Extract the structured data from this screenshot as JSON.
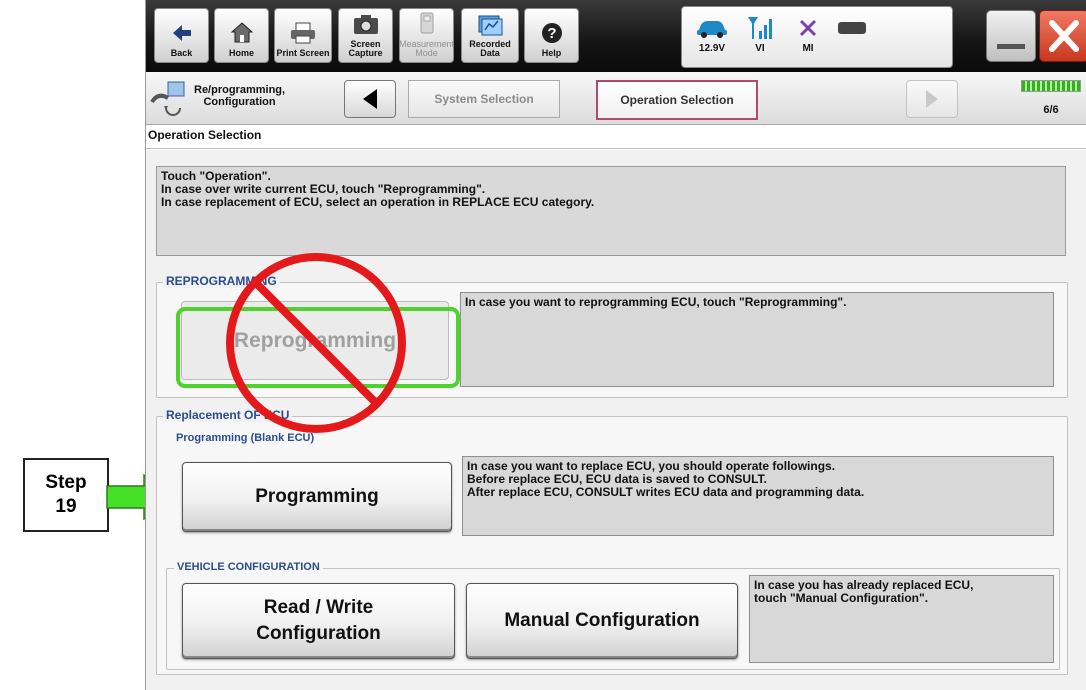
{
  "callout": {
    "step_label": "Step",
    "step_number": "19"
  },
  "toolbar": {
    "buttons": [
      {
        "label": "Back"
      },
      {
        "label": "Home"
      },
      {
        "label": "Print Screen"
      },
      {
        "label": "Screen\nCapture"
      },
      {
        "label": "Measurement\nMode"
      },
      {
        "label": "Recorded\nData"
      },
      {
        "label": "Help"
      }
    ],
    "status": {
      "voltage": "12.9V",
      "vi": "VI",
      "mi": "MI"
    }
  },
  "breadcrumb": {
    "title": "Re/programming,\nConfiguration",
    "tabs": [
      "System Selection",
      "Operation Selection"
    ],
    "progress_text": "6/6",
    "progress_fraction": 1.0
  },
  "page": {
    "section_title": "Operation Selection",
    "instructions": [
      "Touch \"Operation\".",
      "In case over write current ECU, touch \"Reprogramming\".",
      "In case replacement of ECU, select an operation in REPLACE ECU category."
    ]
  },
  "reprogramming": {
    "group_label": "REPROGRAMMING",
    "button_label": "Reprogramming",
    "description": "In case you want to reprogramming ECU, touch \"Reprogramming\"."
  },
  "replacement": {
    "group_label": "Replacement OF ECU",
    "sub_label": "Programming (Blank ECU)",
    "button_label": "Programming",
    "description": [
      "In case you want to replace ECU, you should operate followings.",
      "Before replace ECU, ECU data is saved to CONSULT.",
      "After replace ECU, CONSULT writes ECU data and programming data."
    ]
  },
  "vehicle_config": {
    "group_label": "VEHICLE CONFIGURATION",
    "read_write_label": [
      "Read / Write",
      "Configuration"
    ],
    "manual_label": "Manual Configuration",
    "description": [
      "In case you has already replaced ECU,",
      "touch \"Manual Configuration\"."
    ]
  },
  "colors": {
    "highlight": "#4fd12e",
    "accent": "#2a4d8f",
    "no_sign": "#e3191c"
  }
}
